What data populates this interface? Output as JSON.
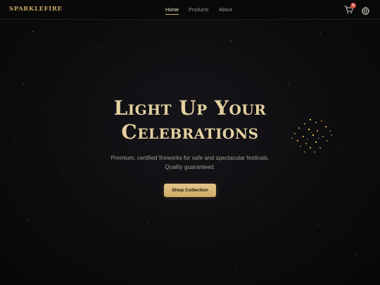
{
  "brand": {
    "name": "SPARKLEFIRE",
    "color": "#c9a866"
  },
  "nav": {
    "items": [
      {
        "label": "Home",
        "active": true
      },
      {
        "label": "Products",
        "active": false
      },
      {
        "label": "About",
        "active": false
      }
    ]
  },
  "header_actions": {
    "cart_icon": "cart-icon",
    "cart_count": "0",
    "settings_icon": "gear-icon"
  },
  "hero": {
    "title_line1": "Light Up Your",
    "title_line2": "Celebrations",
    "subtitle_line1": "Premium, certified fireworks for safe and spectacular festivals.",
    "subtitle_line2": "Quality guaranteed.",
    "cta_label": "Shop Collection"
  },
  "colors": {
    "accent": "#d9b36d",
    "background": "#0b0a0a",
    "badge": "#d34a3c",
    "title": "#e5d0a0"
  }
}
